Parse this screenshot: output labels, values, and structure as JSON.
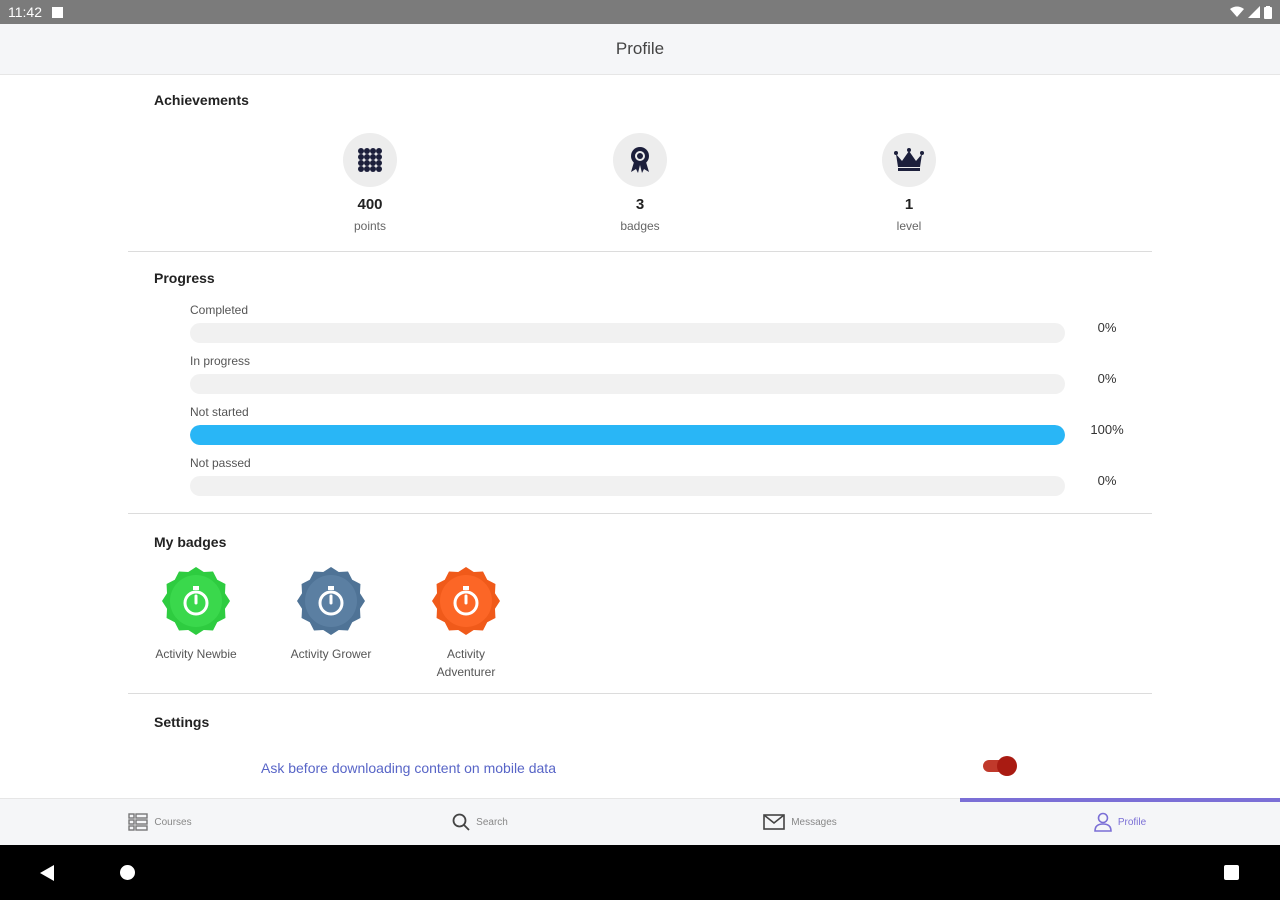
{
  "status_bar": {
    "time": "11:42"
  },
  "app_bar": {
    "title": "Profile"
  },
  "achievements": {
    "title": "Achievements",
    "items": [
      {
        "value": "400",
        "label": "points",
        "icon": "grid-icon"
      },
      {
        "value": "3",
        "label": "badges",
        "icon": "award-icon"
      },
      {
        "value": "1",
        "label": "level",
        "icon": "crown-icon"
      }
    ]
  },
  "progress": {
    "title": "Progress",
    "rows": [
      {
        "label": "Completed",
        "percent_text": "0%",
        "fraction": 0
      },
      {
        "label": "In progress",
        "percent_text": "0%",
        "fraction": 0
      },
      {
        "label": "Not started",
        "percent_text": "100%",
        "fraction": 1
      },
      {
        "label": "Not passed",
        "percent_text": "0%",
        "fraction": 0
      }
    ],
    "fill_color": "#29b6f6"
  },
  "badges": {
    "title": "My badges",
    "items": [
      {
        "label": "Activity Newbie",
        "color": "#2ecc40"
      },
      {
        "label": "Activity Grower",
        "color": "#4f7396"
      },
      {
        "label": "Activity Adventurer",
        "color": "#f05a1a"
      }
    ]
  },
  "settings": {
    "title": "Settings",
    "mobile_data_label": "Ask before downloading content on mobile data",
    "mobile_data_enabled": true
  },
  "bottom_nav": {
    "items": [
      {
        "label": "Courses",
        "icon": "courses-icon",
        "active": false
      },
      {
        "label": "Search",
        "icon": "search-icon",
        "active": false
      },
      {
        "label": "Messages",
        "icon": "messages-icon",
        "active": false
      },
      {
        "label": "Profile",
        "icon": "profile-icon",
        "active": true
      }
    ],
    "active_color": "#7b6fd6"
  }
}
